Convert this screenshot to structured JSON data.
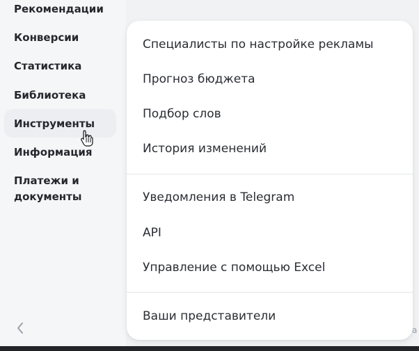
{
  "sidebar": {
    "items": [
      {
        "label": "Рекомендации"
      },
      {
        "label": "Конверсии"
      },
      {
        "label": "Статистика"
      },
      {
        "label": "Библиотека"
      },
      {
        "label": "Инструменты"
      },
      {
        "label": "Информация"
      },
      {
        "label": "Платежи и"
      },
      {
        "label": "документы"
      }
    ],
    "collapse_icon": "chevron-left-icon"
  },
  "menu": {
    "items": [
      {
        "label": "Специалисты по настройке рекламы"
      },
      {
        "label": "Прогноз бюджета"
      },
      {
        "label": "Подбор слов"
      },
      {
        "label": "История изменений"
      },
      {
        "label": "Уведомления в Telegram"
      },
      {
        "label": "API"
      },
      {
        "label": "Управление с помощью Excel"
      },
      {
        "label": "Ваши представители"
      }
    ]
  },
  "background_hint": {
    "edge_text": "a"
  },
  "colors": {
    "sidebar_bg": "#f5f6f8",
    "menu_bg": "#ffffff",
    "text_primary": "#2a2d33",
    "divider": "#e3e5e8",
    "bottom_bar": "#222428"
  }
}
